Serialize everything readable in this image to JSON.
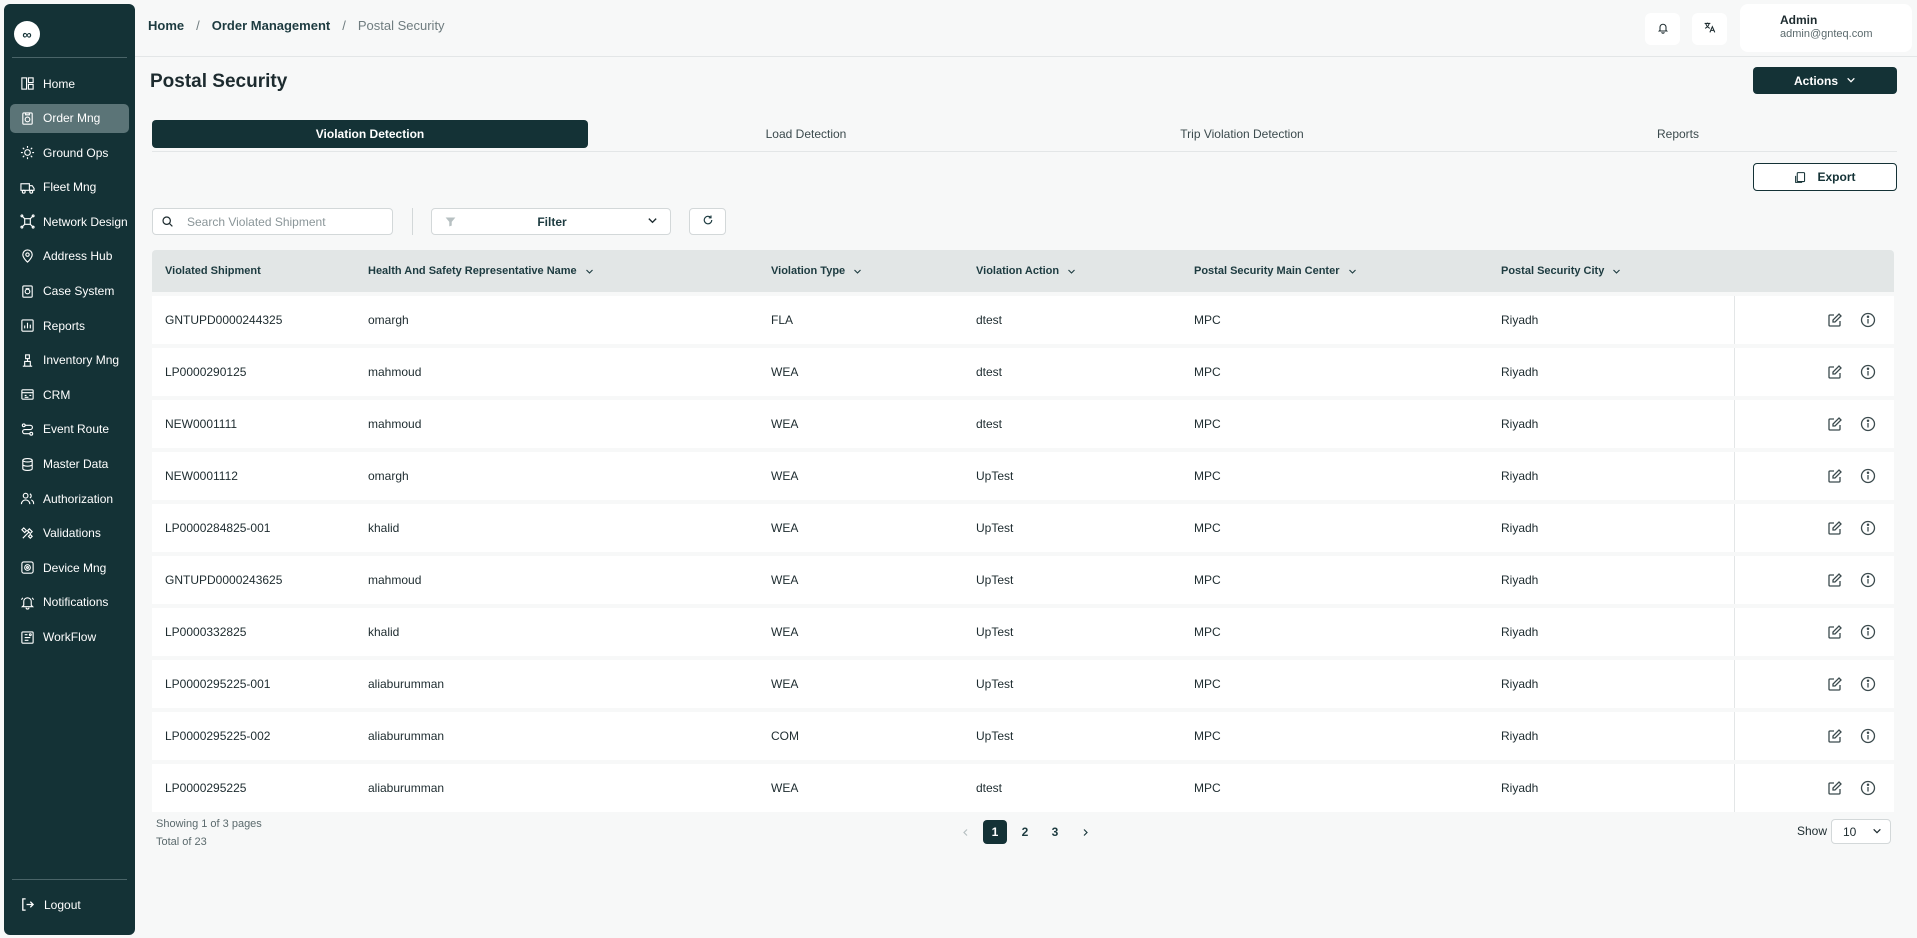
{
  "app": {
    "logo_glyph": "∞"
  },
  "sidebar": {
    "items": [
      {
        "label": "Home",
        "icon": "home-icon",
        "active": false
      },
      {
        "label": "Order Mng",
        "icon": "order-icon",
        "active": true
      },
      {
        "label": "Ground Ops",
        "icon": "ground-ops-icon",
        "active": false
      },
      {
        "label": "Fleet Mng",
        "icon": "truck-icon",
        "active": false
      },
      {
        "label": "Network Design",
        "icon": "network-icon",
        "active": false
      },
      {
        "label": "Address Hub",
        "icon": "map-pin-icon",
        "active": false
      },
      {
        "label": "Case System",
        "icon": "case-icon",
        "active": false
      },
      {
        "label": "Reports",
        "icon": "reports-icon",
        "active": false
      },
      {
        "label": "Inventory Mng",
        "icon": "inventory-icon",
        "active": false
      },
      {
        "label": "CRM",
        "icon": "crm-icon",
        "active": false
      },
      {
        "label": "Event Route",
        "icon": "route-icon",
        "active": false
      },
      {
        "label": "Master Data",
        "icon": "database-icon",
        "active": false
      },
      {
        "label": "Authorization",
        "icon": "users-icon",
        "active": false
      },
      {
        "label": "Validations",
        "icon": "tools-icon",
        "active": false
      },
      {
        "label": "Device Mng",
        "icon": "device-icon",
        "active": false
      },
      {
        "label": "Notifications",
        "icon": "bell-icon",
        "active": false
      },
      {
        "label": "WorkFlow",
        "icon": "workflow-icon",
        "active": false
      }
    ],
    "logout_label": "Logout"
  },
  "header": {
    "breadcrumbs": [
      "Home",
      "Order Management",
      "Postal Security"
    ],
    "separator": "/",
    "user": {
      "name": "Admin",
      "email": "admin@gnteq.com"
    }
  },
  "page": {
    "title": "Postal Security",
    "actions_label": "Actions",
    "tabs": [
      {
        "label": "Violation Detection",
        "active": true
      },
      {
        "label": "Load Detection",
        "active": false
      },
      {
        "label": "Trip Violation Detection",
        "active": false
      },
      {
        "label": "Reports",
        "active": false
      }
    ],
    "export_label": "Export",
    "search_placeholder": "Search Violated Shipment",
    "filter_label": "Filter"
  },
  "table": {
    "columns": [
      "Violated Shipment",
      "Health And Safety Representative Name",
      "Violation Type",
      "Violation Action",
      "Postal Security Main Center",
      "Postal Security City"
    ],
    "rows": [
      [
        "GNTUPD0000244325",
        "omargh",
        "FLA",
        "dtest",
        "MPC",
        "Riyadh"
      ],
      [
        "LP0000290125",
        "mahmoud",
        "WEA",
        "dtest",
        "MPC",
        "Riyadh"
      ],
      [
        "NEW0001111",
        "mahmoud",
        "WEA",
        "dtest",
        "MPC",
        "Riyadh"
      ],
      [
        "NEW0001112",
        "omargh",
        "WEA",
        "UpTest",
        "MPC",
        "Riyadh"
      ],
      [
        "LP0000284825-001",
        "khalid",
        "WEA",
        "UpTest",
        "MPC",
        "Riyadh"
      ],
      [
        "GNTUPD0000243625",
        "mahmoud",
        "WEA",
        "UpTest",
        "MPC",
        "Riyadh"
      ],
      [
        "LP0000332825",
        "khalid",
        "WEA",
        "UpTest",
        "MPC",
        "Riyadh"
      ],
      [
        "LP0000295225-001",
        "aliaburumman",
        "WEA",
        "UpTest",
        "MPC",
        "Riyadh"
      ],
      [
        "LP0000295225-002",
        "aliaburumman",
        "COM",
        "UpTest",
        "MPC",
        "Riyadh"
      ],
      [
        "LP0000295225",
        "aliaburumman",
        "WEA",
        "dtest",
        "MPC",
        "Riyadh"
      ]
    ]
  },
  "pagination": {
    "showing_text": "Showing 1 of 3 pages",
    "total_text": "Total of 23",
    "pages": [
      "1",
      "2",
      "3"
    ],
    "current_page": "1",
    "show_label": "Show",
    "page_size": "10"
  },
  "colors": {
    "primary": "#143236",
    "sidebar_active": "#5b7477",
    "background": "#f7f8f8"
  }
}
